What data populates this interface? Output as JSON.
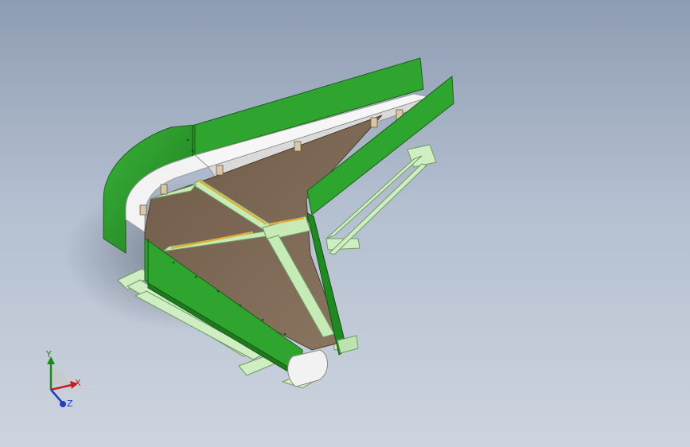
{
  "viewport": {
    "background_top": "#8e9cb3",
    "background_bottom": "#cdd4df"
  },
  "model": {
    "description_icon": "curved-belt-conveyor-3d-model",
    "colors": {
      "side_guard": "#2e9e2e",
      "side_guard_dark": "#1f7a1f",
      "belt": "#f2f2f2",
      "bed": "#7a6652",
      "frame": "#bfe3b0",
      "frame_edge": "#7fae72",
      "rib_yellow": "#e2b13c"
    }
  },
  "triad": {
    "x_label": "X",
    "y_label": "Y",
    "z_label": "Z",
    "colors": {
      "x": "#c42020",
      "y": "#1a8a1a",
      "z": "#2040c0"
    }
  }
}
